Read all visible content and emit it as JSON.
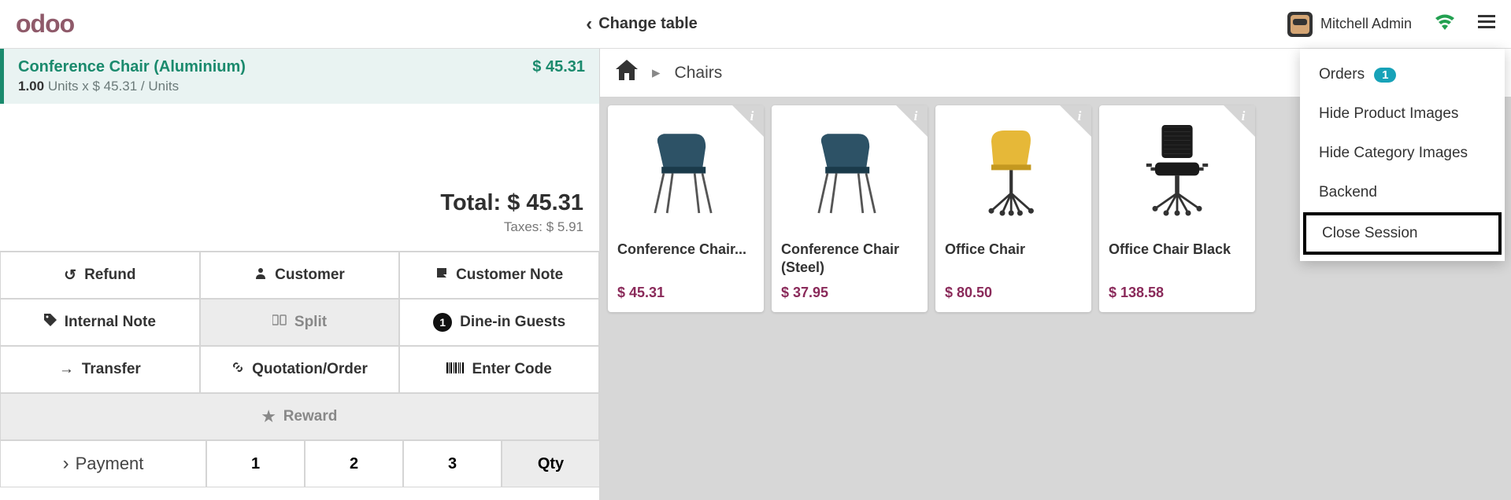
{
  "header": {
    "logo": "odoo",
    "change_table": "Change table",
    "user_name": "Mitchell Admin"
  },
  "order": {
    "line": {
      "name": "Conference Chair (Aluminium)",
      "qty_prefix": "1.00",
      "qty_rest": "  Units x $ 45.31 / Units",
      "price": "$ 45.31"
    },
    "total_label": "Total: $ 45.31",
    "taxes_label": "Taxes: $ 5.91"
  },
  "actions": {
    "refund": "Refund",
    "customer": "Customer",
    "customer_note": "Customer Note",
    "internal_note": "Internal Note",
    "split": "Split",
    "guests_count": "1",
    "guests": "Dine-in Guests",
    "transfer": "Transfer",
    "quotation": "Quotation/Order",
    "enter_code": "Enter Code",
    "reward": "Reward",
    "payment": "Payment"
  },
  "numpad": {
    "n1": "1",
    "n2": "2",
    "n3": "3",
    "qty": "Qty"
  },
  "breadcrumb": {
    "category": "Chairs"
  },
  "products": [
    {
      "name": "Conference Chair...",
      "price": "$ 45.31"
    },
    {
      "name": "Conference Chair (Steel)",
      "price": "$ 37.95"
    },
    {
      "name": "Office Chair",
      "price": "$ 80.50"
    },
    {
      "name": "Office Chair Black",
      "price": "$ 138.58"
    }
  ],
  "menu": {
    "orders": "Orders",
    "orders_badge": "1",
    "hide_product_images": "Hide Product Images",
    "hide_category_images": "Hide Category Images",
    "backend": "Backend",
    "close_session": "Close Session"
  }
}
